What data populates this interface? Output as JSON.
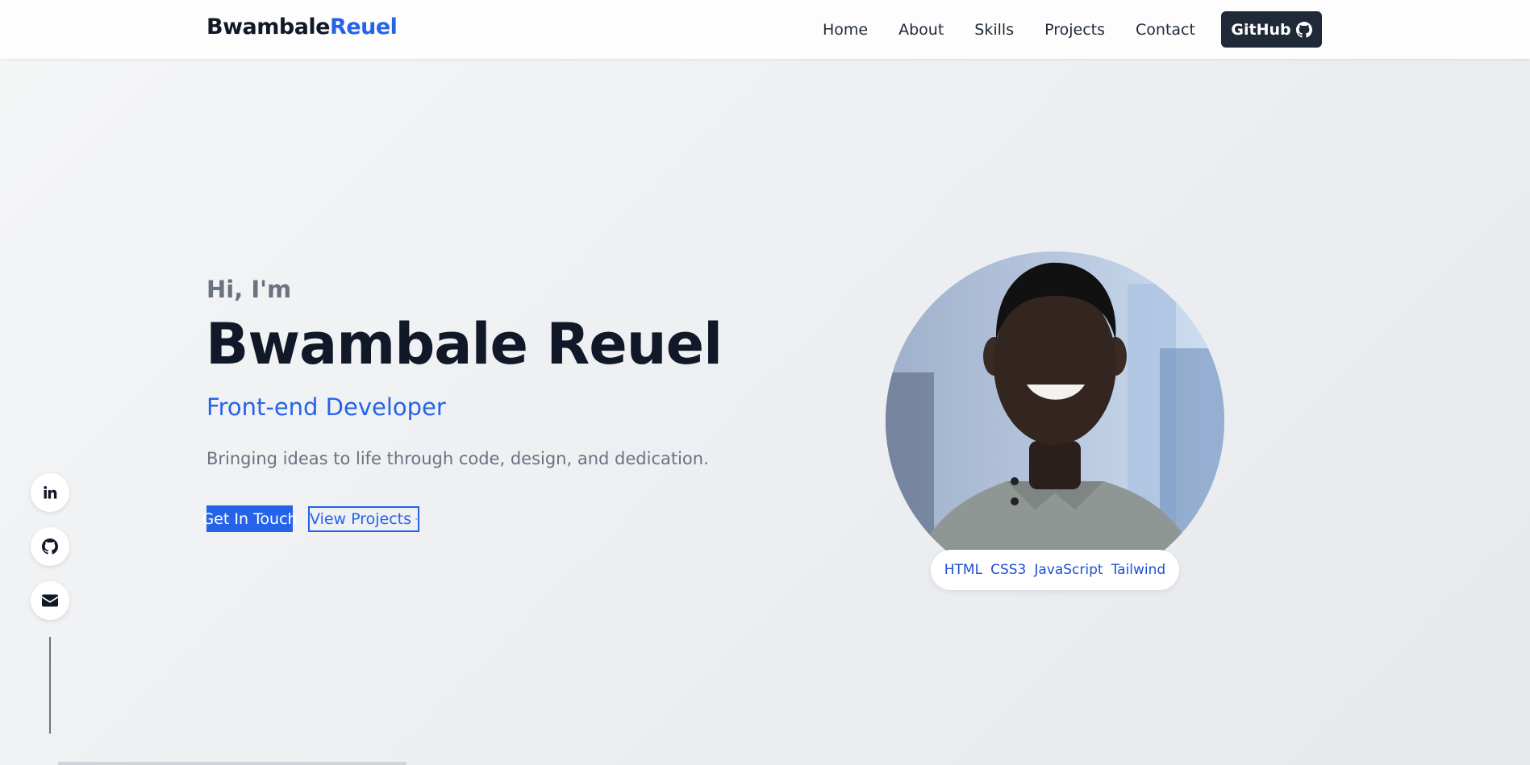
{
  "brand": {
    "part1": "Bwambale",
    "part2": "Reuel"
  },
  "nav": {
    "items": [
      {
        "label": "Home"
      },
      {
        "label": "About"
      },
      {
        "label": "Skills"
      },
      {
        "label": "Projects"
      },
      {
        "label": "Contact"
      }
    ],
    "github_label": "GitHub",
    "github_icon": "github-icon"
  },
  "hero": {
    "greeting": "Hi, I'm",
    "name": "Bwambale Reuel",
    "role": "Front-end Developer",
    "tagline": "Bringing ideas to life through code, design, and dedication.",
    "primary_cta": "Get In Touch",
    "secondary_cta": "View Projects",
    "secondary_icon": "arrow-right-icon"
  },
  "portrait": {
    "skills": [
      "HTML",
      "CSS3",
      "JavaScript",
      "Tailwind"
    ]
  },
  "social": {
    "icons": [
      "linkedin-icon",
      "github-icon",
      "mail-icon"
    ]
  },
  "colors": {
    "accent": "#2563eb",
    "dark": "#1f2937",
    "muted": "#6b7280"
  }
}
